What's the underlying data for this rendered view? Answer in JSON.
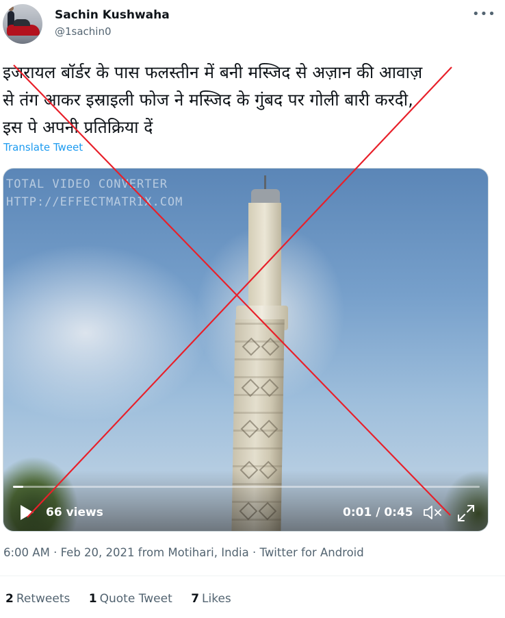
{
  "author": {
    "name": "Sachin Kushwaha",
    "handle": "@1sachin0",
    "more_icon": "ellipsis-icon"
  },
  "tweet": {
    "lines": [
      "इजरायल बॉर्डर के पास फलस्तीन में बनी मस्जिद से अज़ान की आवाज़",
      "से तंग आकर इस्राइली फोज ने मस्जिद के गुंबद पर गोली बारी करदी,",
      "इस पे अपनी प्रतिक्रिया दें"
    ],
    "translate_label": "Translate Tweet"
  },
  "video": {
    "watermark_lines": [
      "TOTAL VIDEO CONVERTER",
      "HTTP://EFFECTMATRIX.COM"
    ],
    "views": "66 views",
    "time": "0:01 / 0:45",
    "progress": 0.022,
    "icons": {
      "play": "play-icon",
      "mute": "mute-icon",
      "fullscreen": "fullscreen-icon"
    }
  },
  "meta": {
    "time": "6:00 AM",
    "date": "Feb 20, 2021",
    "location": "from Motihari, India",
    "client": "Twitter for Android",
    "separator": "·"
  },
  "stats": {
    "retweets_count": "2",
    "retweets_label": "Retweets",
    "quotes_count": "1",
    "quotes_label": "Quote Tweet",
    "likes_count": "7",
    "likes_label": "Likes"
  },
  "colors": {
    "link": "#1d9bf0",
    "secondary_text": "#536471",
    "cross_overlay": "#e8202a"
  }
}
